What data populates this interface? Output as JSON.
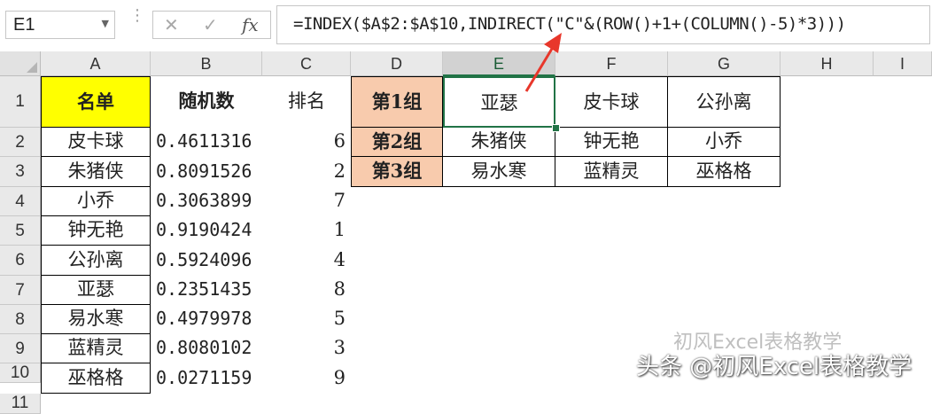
{
  "formula_bar": {
    "name_box": "E1",
    "cancel_icon": "✕",
    "enter_icon": "✓",
    "fx_label": "fx",
    "formula": "=INDEX($A$2:$A$10,INDIRECT(\"C\"&(ROW()+1+(COLUMN()-5)*3)))"
  },
  "columns": [
    "A",
    "B",
    "C",
    "D",
    "E",
    "F",
    "G",
    "H",
    "I"
  ],
  "rows": [
    "1",
    "2",
    "3",
    "4",
    "5",
    "6",
    "7",
    "8",
    "9",
    "10",
    "11"
  ],
  "header_row": {
    "a1": "名单",
    "b1": "随机数",
    "c1": "排名"
  },
  "names": [
    "皮卡球",
    "朱猪侠",
    "小乔",
    "钟无艳",
    "公孙离",
    "亚瑟",
    "易水寒",
    "蓝精灵",
    "巫格格"
  ],
  "randoms": [
    "0.4611316",
    "0.8091526",
    "0.3063899",
    "0.9190424",
    "0.5924096",
    "0.2351435",
    "0.4979978",
    "0.8080102",
    "0.0271159"
  ],
  "ranks": [
    "6",
    "2",
    "7",
    "1",
    "4",
    "8",
    "5",
    "3",
    "9"
  ],
  "groups": [
    {
      "label": "第1组",
      "members": [
        "亚瑟",
        "皮卡球",
        "公孙离"
      ]
    },
    {
      "label": "第2组",
      "members": [
        "朱猪侠",
        "钟无艳",
        "小乔"
      ]
    },
    {
      "label": "第3组",
      "members": [
        "易水寒",
        "蓝精灵",
        "巫格格"
      ]
    }
  ],
  "colors": {
    "a1_fill": "#ffff00",
    "group_fill": "#f8cbad",
    "selection": "#217346",
    "arrow": "#e8372b"
  },
  "watermark": {
    "line1": "初风Excel表格教学",
    "line2": "头条 @初风Excel表格教学"
  }
}
